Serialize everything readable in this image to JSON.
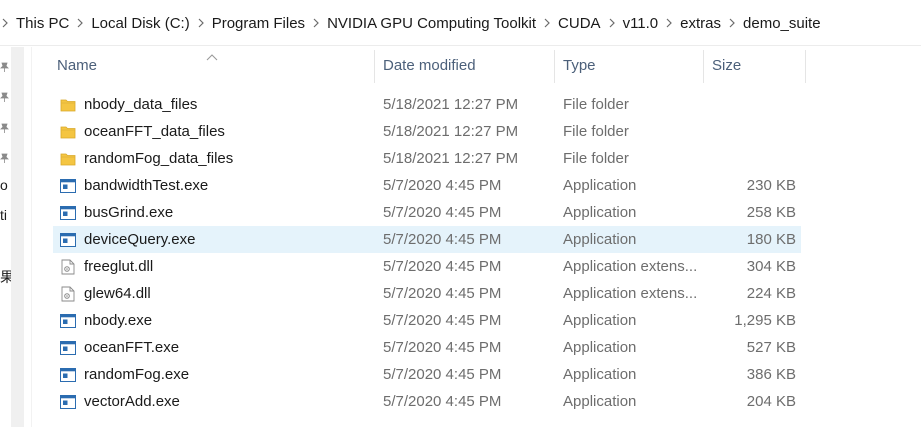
{
  "breadcrumb": [
    "This PC",
    "Local Disk (C:)",
    "Program Files",
    "NVIDIA GPU Computing Toolkit",
    "CUDA",
    "v11.0",
    "extras",
    "demo_suite"
  ],
  "nav_fragments": [
    "o",
    "ti",
    "果"
  ],
  "columns": {
    "name": "Name",
    "date": "Date modified",
    "type": "Type",
    "size": "Size"
  },
  "colors": {
    "selected_row": "#e5f3fb",
    "header_text": "#4c607a",
    "folder": "#f4c542",
    "app_icon": "#2b6cb0"
  },
  "files": [
    {
      "icon": "folder-icon",
      "name": "nbody_data_files",
      "date": "5/18/2021 12:27 PM",
      "type": "File folder",
      "size": ""
    },
    {
      "icon": "folder-icon",
      "name": "oceanFFT_data_files",
      "date": "5/18/2021 12:27 PM",
      "type": "File folder",
      "size": ""
    },
    {
      "icon": "folder-icon",
      "name": "randomFog_data_files",
      "date": "5/18/2021 12:27 PM",
      "type": "File folder",
      "size": ""
    },
    {
      "icon": "application-icon",
      "name": "bandwidthTest.exe",
      "date": "5/7/2020 4:45 PM",
      "type": "Application",
      "size": "230 KB"
    },
    {
      "icon": "application-icon",
      "name": "busGrind.exe",
      "date": "5/7/2020 4:45 PM",
      "type": "Application",
      "size": "258 KB"
    },
    {
      "icon": "application-icon",
      "name": "deviceQuery.exe",
      "date": "5/7/2020 4:45 PM",
      "type": "Application",
      "size": "180 KB",
      "selected": true
    },
    {
      "icon": "dll-file-icon",
      "name": "freeglut.dll",
      "date": "5/7/2020 4:45 PM",
      "type": "Application extens...",
      "size": "304 KB"
    },
    {
      "icon": "dll-file-icon",
      "name": "glew64.dll",
      "date": "5/7/2020 4:45 PM",
      "type": "Application extens...",
      "size": "224 KB"
    },
    {
      "icon": "application-icon",
      "name": "nbody.exe",
      "date": "5/7/2020 4:45 PM",
      "type": "Application",
      "size": "1,295 KB"
    },
    {
      "icon": "application-icon",
      "name": "oceanFFT.exe",
      "date": "5/7/2020 4:45 PM",
      "type": "Application",
      "size": "527 KB"
    },
    {
      "icon": "application-icon",
      "name": "randomFog.exe",
      "date": "5/7/2020 4:45 PM",
      "type": "Application",
      "size": "386 KB"
    },
    {
      "icon": "application-icon",
      "name": "vectorAdd.exe",
      "date": "5/7/2020 4:45 PM",
      "type": "Application",
      "size": "204 KB"
    }
  ]
}
